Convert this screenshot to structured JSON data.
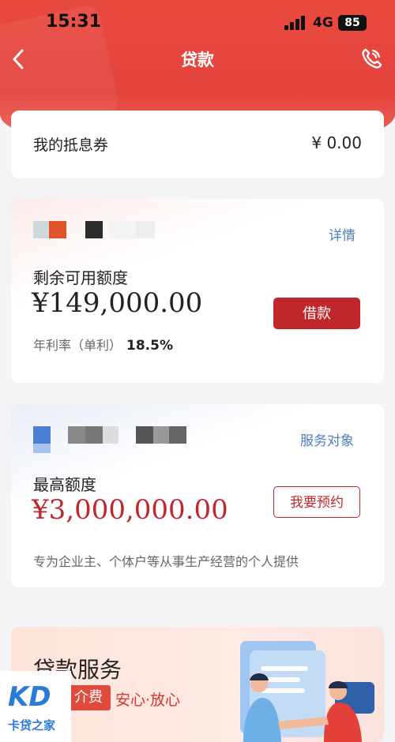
{
  "status_bar": {
    "time": "15:31",
    "network": "4G",
    "battery": "85"
  },
  "nav": {
    "title": "贷款",
    "back_icon": "chevron-left-icon",
    "phone_icon": "phone-icon"
  },
  "coupon": {
    "label": "我的抵息券",
    "value": "¥ 0.00"
  },
  "loan_product": {
    "detail_link": "详情",
    "remaining_label": "剩余可用额度",
    "remaining_amount": "¥149,000.00",
    "borrow_button": "借款",
    "rate_label": "年利率（单利）",
    "rate_value": "18.5%"
  },
  "business_loan": {
    "service_target_link": "服务对象",
    "max_label": "最高额度",
    "max_amount": "¥3,000,000.00",
    "reserve_button": "我要预约",
    "description": "专为企业主、个体户等从事生产经营的个人提供"
  },
  "service_banner": {
    "title": "贷款服务",
    "fee_tag": "介费",
    "slogan": "安心·放心"
  },
  "watermark": {
    "logo": "KD",
    "text": "卡贷之家"
  },
  "colors": {
    "header_red": "#e4433c",
    "button_red": "#c0272d",
    "link_blue": "#4a7fc1"
  }
}
